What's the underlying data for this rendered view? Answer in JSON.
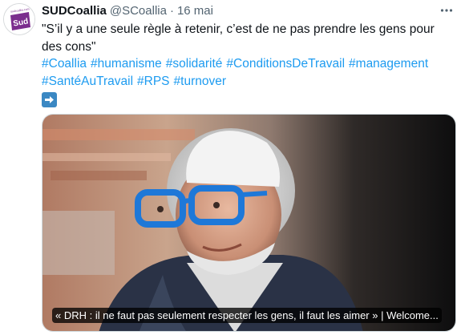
{
  "tweet": {
    "display_name": "SUDCoallia",
    "handle": "@SCoallia",
    "separator": "·",
    "date": "16 mai",
    "avatar_text": "Sud",
    "avatar_small_text": "sudcoallia.com",
    "quote": "\"S’il y a une seule règle à retenir, c’est de ne pas prendre les gens pour des cons\"",
    "hashtags": [
      "#Coallia",
      "#humanisme",
      "#solidarité",
      "#ConditionsDeTravail",
      "#management",
      "#SantéAuTravail",
      "#RPS",
      "#turnover"
    ],
    "arrow_emoji": "right-arrow-emoji",
    "link_card_caption": "« DRH : il ne faut pas seulement respecter les gens, il faut les aimer » | Welcome..."
  },
  "colors": {
    "link": "#1d9bf0",
    "brand_purple": "#7b2d8e",
    "glasses_blue": "#1e78d8",
    "muted": "#536471"
  },
  "icons": [
    "more-options-icon",
    "right-arrow-emoji"
  ]
}
